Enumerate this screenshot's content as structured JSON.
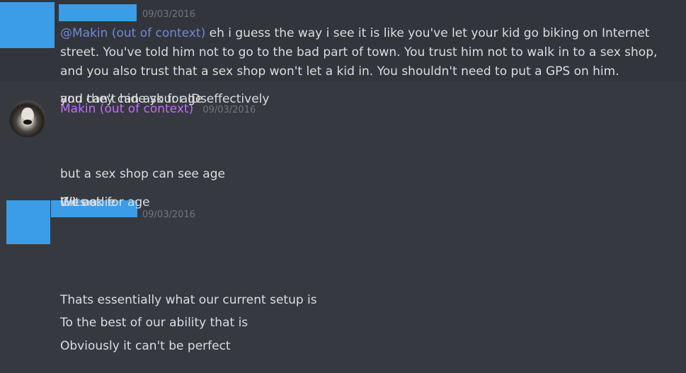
{
  "messages": [
    {
      "timestamp": "09/03/2016",
      "mention": "@Makin (out of context)",
      "text": " eh i guess the way i see it is like you've let your kid go biking on Internet street. You've told him not to go to the bad part of town. You trust him not to walk in to a sex shop, and you also trust that a sex shop won't let a kid in. You shouldn't need to put a GPS on him."
    },
    {
      "author": "Makin (out of context)",
      "timestamp": "09/03/2016",
      "lines": [
        "but a sex shop can see age",
        "you can't hide your age effectively",
        "and they can ask for IDs"
      ]
    },
    {
      "timestamp": "09/03/2016",
      "lines": [
        "Thats essentially what our current setup is",
        "To the best of our ability that is",
        "Obviously it can't be perfect",
        "We ask for age",
        "If its a lie",
        "Git oot"
      ]
    }
  ],
  "colors": {
    "background": "#36393f",
    "highlighted_background": "#32353b",
    "redaction": "#3b9de8",
    "username": "#c56aff",
    "mention": "#7289da",
    "timestamp": "#72767d",
    "message_text": "#dcddde"
  },
  "icons": {
    "avatar_2": "husky-avatar-icon"
  }
}
